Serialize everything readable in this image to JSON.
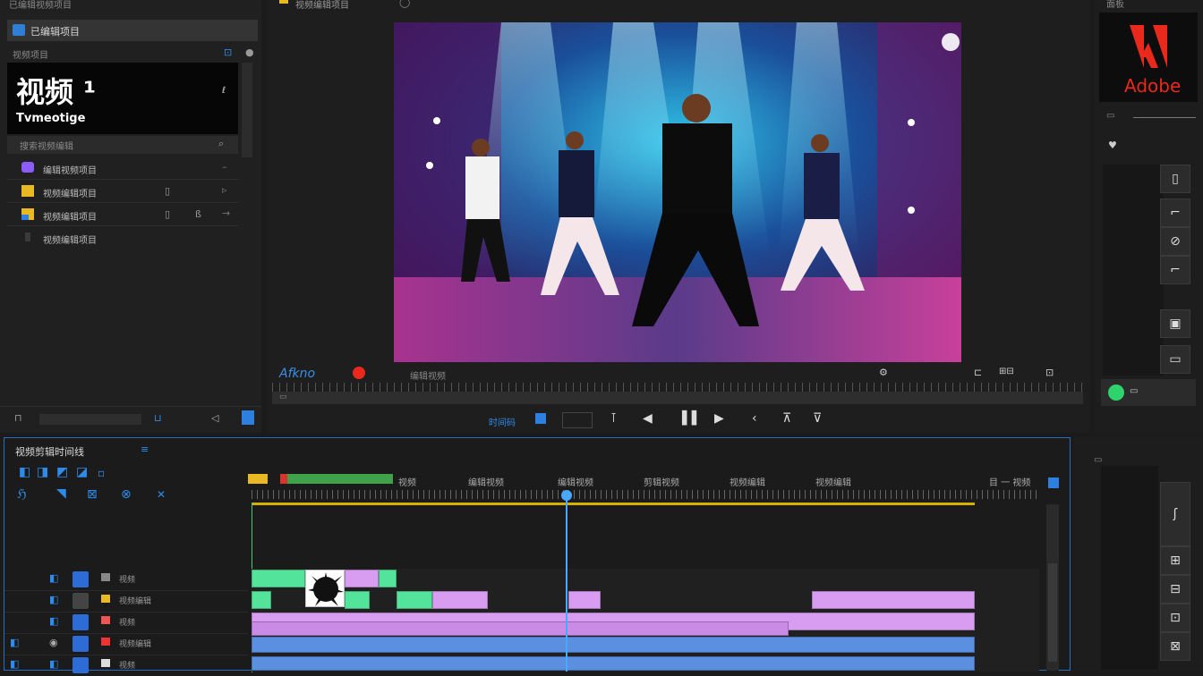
{
  "project_panel": {
    "title": "已编辑视频项目",
    "sequence_name": "已编辑项目",
    "preview_label": "视频项目",
    "preview_big_text": "视频 ¹",
    "preview_sub_text": "Tvmeotige",
    "filter_label": "搜索视频编辑",
    "items": [
      {
        "name": "编辑视频项目",
        "color": "#8b5cf6"
      },
      {
        "name": "视频编辑项目",
        "color": "#e8b923"
      },
      {
        "name": "视频编辑项目",
        "color": "#e8b923"
      },
      {
        "name": "视频编辑项目",
        "color": "#3a3a3a"
      }
    ]
  },
  "monitor": {
    "tab_label": "视频编辑项目",
    "watermark": "Afkno",
    "timecode": "编辑视频",
    "playback_label": "时间码",
    "controls": [
      "bracket-in-icon",
      "step-back-icon",
      "play-icon",
      "step-forward-icon",
      "bracket-out-icon",
      "export-icon"
    ]
  },
  "brand": {
    "logo_text": "Adobe",
    "accent": "#e8291c"
  },
  "right_panel": {
    "label": "面板"
  },
  "timeline": {
    "title": "视频剪辑时间线",
    "ruler_labels": [
      "视频",
      "编辑视频",
      "编辑视频",
      "剪辑视频",
      "视频编辑",
      "视频编辑",
      "目 一 视频"
    ],
    "tracks": [
      "视频",
      "视频编辑",
      "视频",
      "视频编辑",
      "视频"
    ],
    "playhead_color": "#4aa8ff",
    "colors": {
      "green": "#54e39a",
      "pink": "#d89df0",
      "blue": "#5b8fe0",
      "track_bg": "#1f1f1f"
    }
  }
}
